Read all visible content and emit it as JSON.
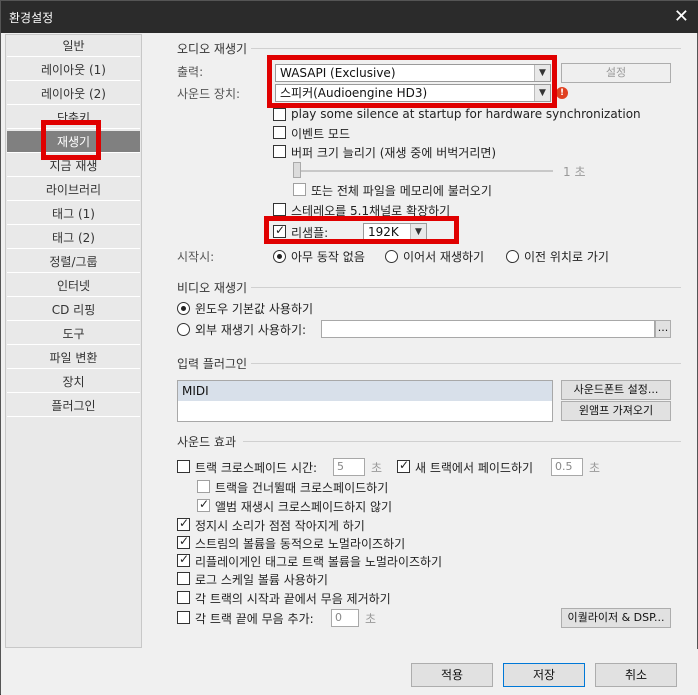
{
  "window": {
    "title": "환경설정",
    "close_icon": "close-icon"
  },
  "sidebar": {
    "items": [
      {
        "label": "일반"
      },
      {
        "label": "레이아웃 (1)"
      },
      {
        "label": "레이아웃 (2)"
      },
      {
        "label": "단축키"
      },
      {
        "label": "재생기",
        "active": true
      },
      {
        "label": "지금 재생"
      },
      {
        "label": "라이브러리"
      },
      {
        "label": "태그 (1)"
      },
      {
        "label": "태그 (2)"
      },
      {
        "label": "정렬/그룹"
      },
      {
        "label": "인터넷"
      },
      {
        "label": "CD 리핑"
      },
      {
        "label": "도구"
      },
      {
        "label": "파일 변환"
      },
      {
        "label": "장치"
      },
      {
        "label": "플러그인"
      }
    ]
  },
  "audio": {
    "group_title": "오디오 재생기",
    "output_label": "출력:",
    "output_value": "WASAPI (Exclusive)",
    "device_label": "사운드 장치:",
    "device_value": "스피커(Audioengine HD3)",
    "settings_button": "설정",
    "play_silence": "play some silence at startup for hardware synchronization",
    "event_mode": "이벤트 모드",
    "buffer_increase": "버퍼 크기 늘리기 (재생 중에 버벅거리면)",
    "buffer_value": "1 초",
    "whole_file": "또는 전체 파일을 메모리에 불러오기",
    "stereo_expand": "스테레오를 5.1채널로 확장하기",
    "resample_label": "리샘플:",
    "resample_value": "192K",
    "start_label": "시작시:",
    "start_options": [
      "아무 동작 없음",
      "이어서 재생하기",
      "이전 위치로 가기"
    ]
  },
  "video": {
    "group_title": "비디오 재생기",
    "default_player": "윈도우 기본값 사용하기",
    "external_player": "외부 재생기 사용하기:",
    "browse": "..."
  },
  "input_plugin": {
    "group_title": "입력 플러그인",
    "items": [
      "MIDI"
    ],
    "soundfont_button": "사운드폰트 설정...",
    "winamp_button": "윈앰프 가져오기"
  },
  "effects": {
    "group_title": "사운드 효과",
    "crossfade_time": "트랙 크로스페이드 시간:",
    "crossfade_value": "5",
    "unit_sec": "초",
    "fade_in_new": "새 트랙에서 페이드하기",
    "fade_in_value": "0.5",
    "crossfade_skip": "트랙을 건너뛸때 크로스페이드하기",
    "album_no_crossfade": "앨범 재생시 크로스페이드하지 않기",
    "fade_out_stop": "정지시 소리가 점점 작아지게 하기",
    "normalize_stream": "스트림의 볼륨을 동적으로 노멀라이즈하기",
    "replaygain": "리플레이게인 태그로 트랙 볼륨을 노멀라이즈하기",
    "log_volume": "로그 스케일 볼륨 사용하기",
    "remove_silence": "각 트랙의 시작과 끝에서 무음 제거하기",
    "add_silence": "각 트랙 끝에 무음 추가:",
    "add_silence_value": "0",
    "equalizer_button": "이퀄라이저 & DSP..."
  },
  "footer": {
    "apply": "적용",
    "save": "저장",
    "cancel": "취소"
  },
  "colors": {
    "highlight": "#e00000",
    "active_item": "#808080"
  }
}
